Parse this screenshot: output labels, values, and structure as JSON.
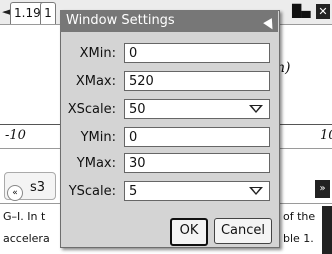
{
  "topbar": {
    "tab_arrow": "◄",
    "tab1_label": "1.19",
    "tab2_label": "1",
    "battery_label": "█▄"
  },
  "graph": {
    "x_min_label": "-10",
    "x_max_label": "10",
    "function_label": "n)"
  },
  "entry": {
    "collapse_icon": "«",
    "text": "s3",
    "expand_icon": "»"
  },
  "question": {
    "line1_left": "G–I. In t",
    "line1_right": "of the",
    "line2_left": "accelera",
    "line2_right": "ble 1."
  },
  "dialog": {
    "title": "Window Settings",
    "fields": [
      {
        "label": "XMin:",
        "value": "0",
        "type": "text"
      },
      {
        "label": "XMax:",
        "value": "520",
        "type": "text"
      },
      {
        "label": "XScale:",
        "value": "50",
        "type": "select"
      },
      {
        "label": "YMin:",
        "value": "0",
        "type": "text"
      },
      {
        "label": "YMax:",
        "value": "30",
        "type": "text"
      },
      {
        "label": "YScale:",
        "value": "5",
        "type": "select"
      }
    ],
    "ok_label": "OK",
    "cancel_label": "Cancel"
  }
}
